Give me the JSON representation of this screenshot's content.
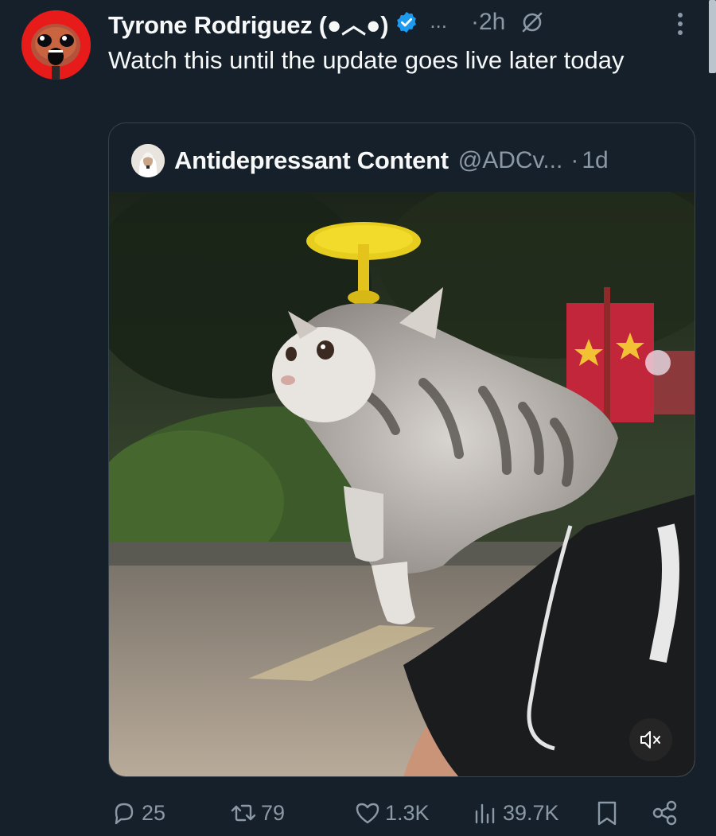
{
  "tweet": {
    "author_name": "Tyrone Rodriguez (●︿●)",
    "handle_truncated": "...",
    "time_separator": "·",
    "time": "2h",
    "text": "Watch this until the update goes live later today"
  },
  "quote": {
    "author_name": "Antidepressant Content",
    "handle": "@ADCv...",
    "time_separator": "·",
    "time": "1d"
  },
  "actions": {
    "replies": "25",
    "reposts": "79",
    "likes": "1.3K",
    "views": "39.7K"
  },
  "icons": {
    "verified": "verified-badge-icon",
    "mute": "mute-conversation-icon",
    "more": "more-options-icon",
    "volume": "volume-muted-icon",
    "reply": "reply-icon",
    "repost": "repost-icon",
    "like": "heart-icon",
    "views": "views-icon",
    "bookmark": "bookmark-icon",
    "share": "share-icon"
  },
  "colors": {
    "background": "#15202b",
    "text_primary": "#f7f9f9",
    "text_secondary": "#8b98a5",
    "border": "#38444d",
    "verified_blue": "#1d9bf0"
  }
}
